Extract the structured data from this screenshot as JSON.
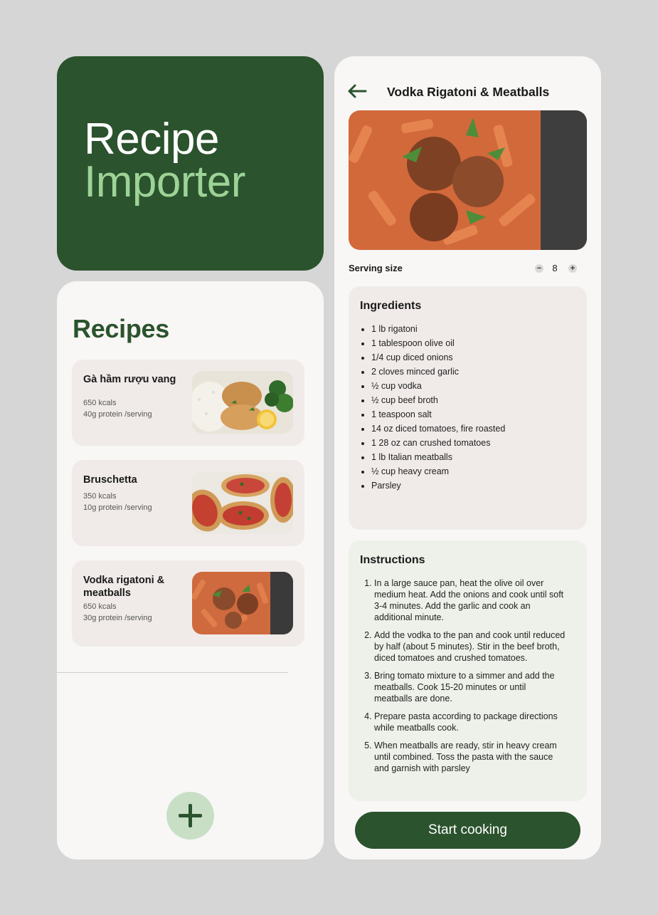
{
  "hero": {
    "title_line1": "Recipe",
    "title_line2": "Importer"
  },
  "recipes": {
    "heading": "Recipes",
    "items": [
      {
        "name": "Gà hầm rượu vang",
        "kcals": "650 kcals",
        "protein": "40g protein /serving",
        "image": "chicken-rice-broccoli-photo"
      },
      {
        "name": "Bruschetta",
        "kcals": "350 kcals",
        "protein": "10g protein /serving",
        "image": "bruschetta-photo"
      },
      {
        "name": "Vodka rigatoni & meatballs",
        "kcals": "650 kcals",
        "protein": "30g protein /serving",
        "image": "rigatoni-meatballs-photo"
      }
    ],
    "fab_icon": "plus-icon"
  },
  "detail": {
    "back_icon": "arrow-left-icon",
    "title": "Vodka Rigatoni & Meatballs",
    "serving": {
      "label": "Serving size",
      "value": "8",
      "minus": "−",
      "plus": "+"
    },
    "ingredients": {
      "heading": "Ingredients",
      "items": [
        "1 lb rigatoni",
        "1 tablespoon olive oil",
        "1/4 cup diced onions",
        "2 cloves minced garlic",
        "½ cup vodka",
        "½ cup beef broth",
        "1 teaspoon salt",
        "14 oz diced tomatoes, fire roasted",
        "1 28 oz can crushed tomatoes",
        "1 lb Italian meatballs",
        "½ cup heavy cream",
        "Parsley"
      ]
    },
    "instructions": {
      "heading": "Instructions",
      "steps": [
        "In a large sauce pan, heat the olive oil over medium heat. Add the onions and cook until soft 3-4 minutes. Add the garlic and cook an additional minute.",
        "Add the vodka to the pan and cook until reduced by half (about 5 minutes). Stir in the beef broth, diced tomatoes and crushed tomatoes.",
        "Bring tomato mixture to a simmer and add the meatballs. Cook 15-20 minutes or until meatballs are done.",
        "Prepare pasta according to package directions while meatballs cook.",
        "When meatballs are ready, stir in heavy cream until combined. Toss the pasta with the sauce and garnish with parsley"
      ]
    },
    "cta": "Start cooking"
  },
  "colors": {
    "brand_green": "#2b532d",
    "accent_light_green": "#9ed397",
    "card_bg": "#f0ebe9",
    "instructions_bg": "#edf1e9"
  }
}
